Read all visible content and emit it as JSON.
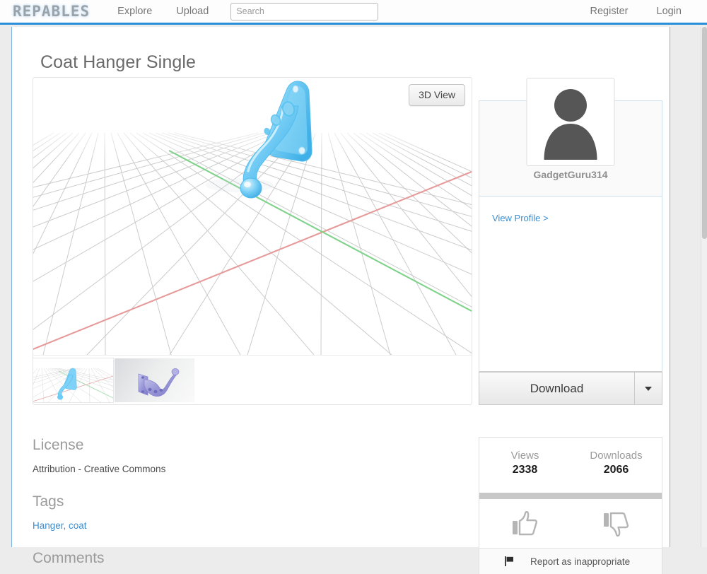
{
  "nav": {
    "logo": "REPABLES",
    "explore": "Explore",
    "upload": "Upload",
    "search_placeholder": "Search",
    "search_value": "",
    "register": "Register",
    "login": "Login",
    "accent_color": "#2a8fd8"
  },
  "model": {
    "title": "Coat Hanger Single",
    "viewer_button": "3D View",
    "thumbnails": [
      {
        "name": "3d-grid-preview",
        "active": true
      },
      {
        "name": "rendered-preview",
        "active": false
      }
    ]
  },
  "author": {
    "username": "GadgetGuru314",
    "view_profile": "View Profile >",
    "avatar_icon": "user-silhouette-icon",
    "download_label": "Download",
    "download_caret_icon": "chevron-down-icon"
  },
  "meta": {
    "license_title": "License",
    "license_value": "Attribution - Creative Commons",
    "tags_title": "Tags",
    "tags": [
      "Hanger",
      "coat"
    ],
    "tags_text": "Hanger, coat",
    "comments_title": "Comments"
  },
  "stats": {
    "views_label": "Views",
    "views_value": "2338",
    "downloads_label": "Downloads",
    "downloads_value": "2066",
    "thumbs_up_icon": "thumbs-up-icon",
    "thumbs_down_icon": "thumbs-down-icon",
    "report_icon": "flag-icon",
    "report_label": "Report as inappropriate"
  },
  "colors": {
    "model_blue": "#6ecbf5",
    "model_purple": "#9a98d8",
    "axis_x": "#e08b8b",
    "axis_y": "#7fd28a",
    "link": "#3b8ed0"
  }
}
